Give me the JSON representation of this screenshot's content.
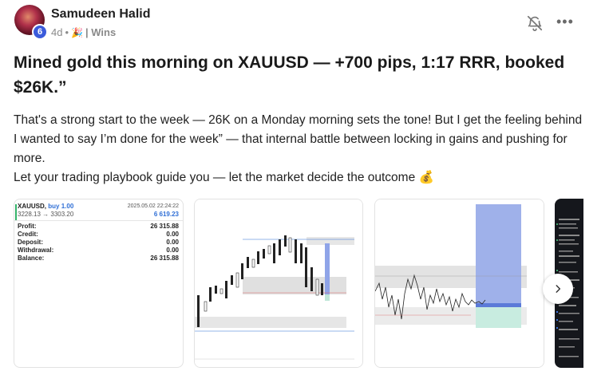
{
  "post": {
    "author": "Samudeen Halid",
    "level": "6",
    "age": "4d",
    "dot": "•",
    "category": "| Wins",
    "title": "Mined gold this morning on XAUUSD — +700 pips, 1:17 RRR, booked $26K.”",
    "body_line1": "That's a strong start to the week — 26K on a Monday morning sets the tone! But I get the feeling behind I wanted to say I’m done for the week” — that internal battle between locking in gains and pushing for more.",
    "body_line2": "Let your trading playbook guide you — let the market decide the outcome 💰"
  },
  "icons": {
    "bell": "bell-off-icon",
    "more": "more-horizontal-icon",
    "category": "party-popper-icon",
    "next": "chevron-right-icon"
  },
  "statement": {
    "symbol": "XAUUSD,",
    "side": "buy 1.00",
    "timestamp": "2025.05.02 22:24:22",
    "prices": "3228.13 → 3303.20",
    "result": "6 619.23",
    "rows": [
      {
        "label": "Profit:",
        "value": "26 315.88"
      },
      {
        "label": "Credit:",
        "value": "0.00"
      },
      {
        "label": "Deposit:",
        "value": "0.00"
      },
      {
        "label": "Withdrawal:",
        "value": "0.00"
      },
      {
        "label": "Balance:",
        "value": "26 315.88"
      }
    ]
  },
  "colors": {
    "accent_blue": "#2f6fd6",
    "profit_green": "#34b36a",
    "level_badge": "#3b5bdb",
    "tp_zone": "#8fa4e8",
    "sl_zone": "#bfe6d8"
  }
}
